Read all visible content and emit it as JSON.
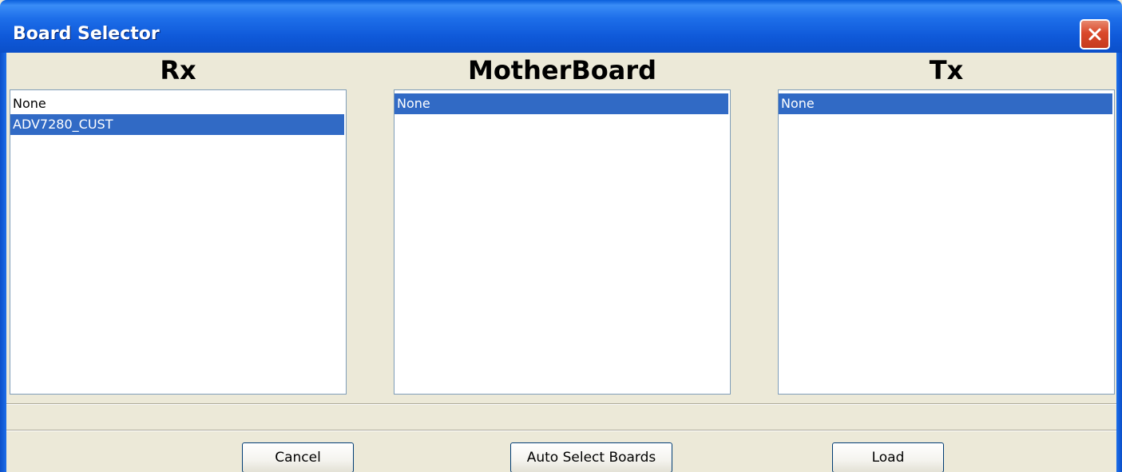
{
  "window": {
    "title": "Board Selector",
    "close_icon": "close-icon"
  },
  "columns": [
    {
      "title": "Rx",
      "items": [
        {
          "label": "None",
          "selected": false
        },
        {
          "label": "ADV7280_CUST",
          "selected": true
        }
      ]
    },
    {
      "title": "MotherBoard",
      "items": [
        {
          "label": "None",
          "selected": true
        }
      ]
    },
    {
      "title": "Tx",
      "items": [
        {
          "label": "None",
          "selected": true
        }
      ]
    }
  ],
  "buttons": {
    "cancel": "Cancel",
    "auto_select": "Auto Select Boards",
    "load": "Load"
  },
  "colors": {
    "selection": "#316AC5",
    "face": "#ECE9D8",
    "titlebar": "#0B4FC9"
  }
}
